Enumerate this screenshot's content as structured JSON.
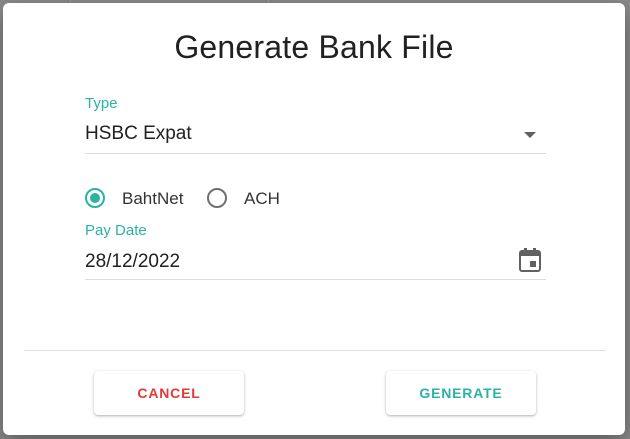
{
  "dialog": {
    "title": "Generate Bank File"
  },
  "type_field": {
    "label": "Type",
    "value": "HSBC Expat"
  },
  "transfer_method": {
    "options": [
      {
        "label": "BahtNet",
        "selected": true
      },
      {
        "label": "ACH",
        "selected": false
      }
    ]
  },
  "pay_date_field": {
    "label": "Pay Date",
    "value": "28/12/2022"
  },
  "actions": {
    "cancel_label": "CANCEL",
    "generate_label": "GENERATE"
  },
  "colors": {
    "accent": "#2ab3a4",
    "danger": "#e53935"
  },
  "icons": {
    "select": "caret-down-icon",
    "date": "calendar-icon"
  }
}
